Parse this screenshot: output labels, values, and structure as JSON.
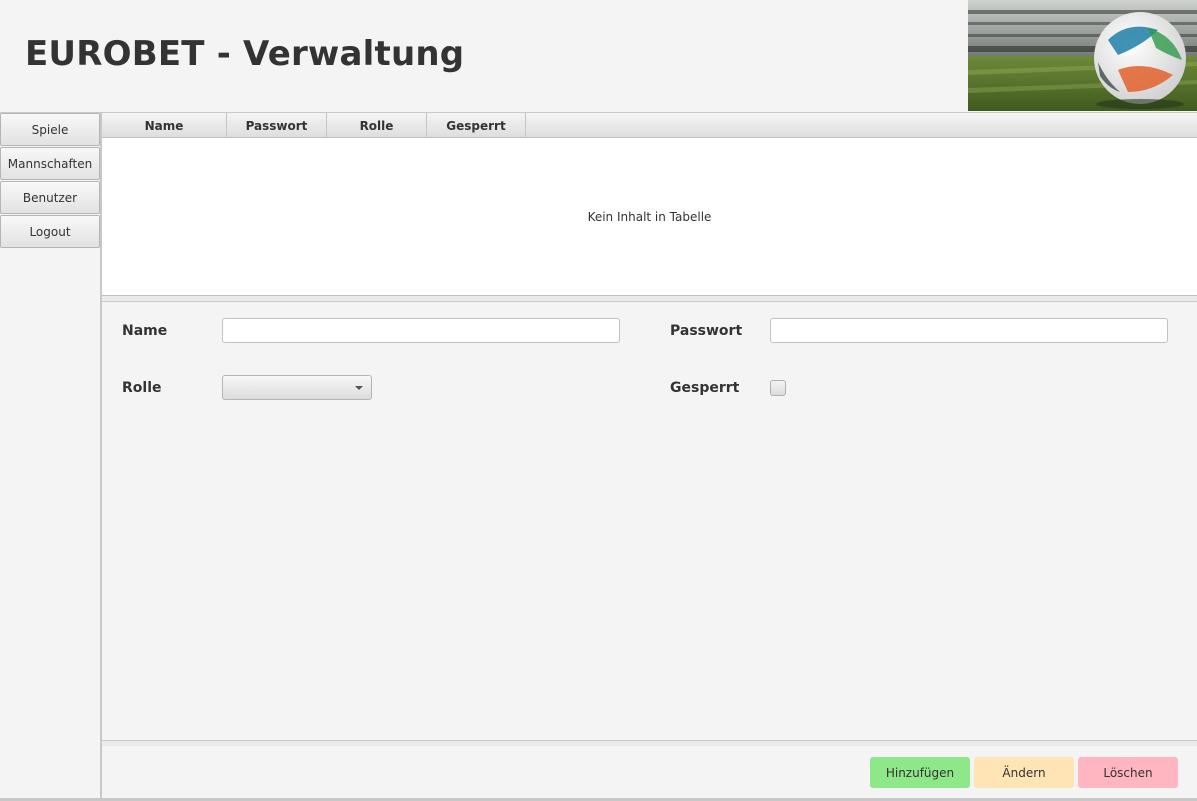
{
  "app": {
    "title": "EUROBET - Verwaltung"
  },
  "sidebar": {
    "items": [
      {
        "label": "Spiele"
      },
      {
        "label": "Mannschaften"
      },
      {
        "label": "Benutzer"
      },
      {
        "label": "Logout"
      }
    ]
  },
  "table": {
    "columns": [
      "Name",
      "Passwort",
      "Rolle",
      "Gesperrt"
    ],
    "rows": [],
    "placeholder": "Kein Inhalt in Tabelle"
  },
  "form": {
    "name_label": "Name",
    "name_value": "",
    "password_label": "Passwort",
    "password_value": "",
    "role_label": "Rolle",
    "role_selected": "",
    "locked_label": "Gesperrt",
    "locked_checked": false
  },
  "actions": {
    "add_label": "Hinzufügen",
    "edit_label": "Ändern",
    "delete_label": "Löschen"
  },
  "colors": {
    "add": "#8ee88a",
    "edit": "#ffe4b5",
    "delete": "#ffb6c1"
  }
}
